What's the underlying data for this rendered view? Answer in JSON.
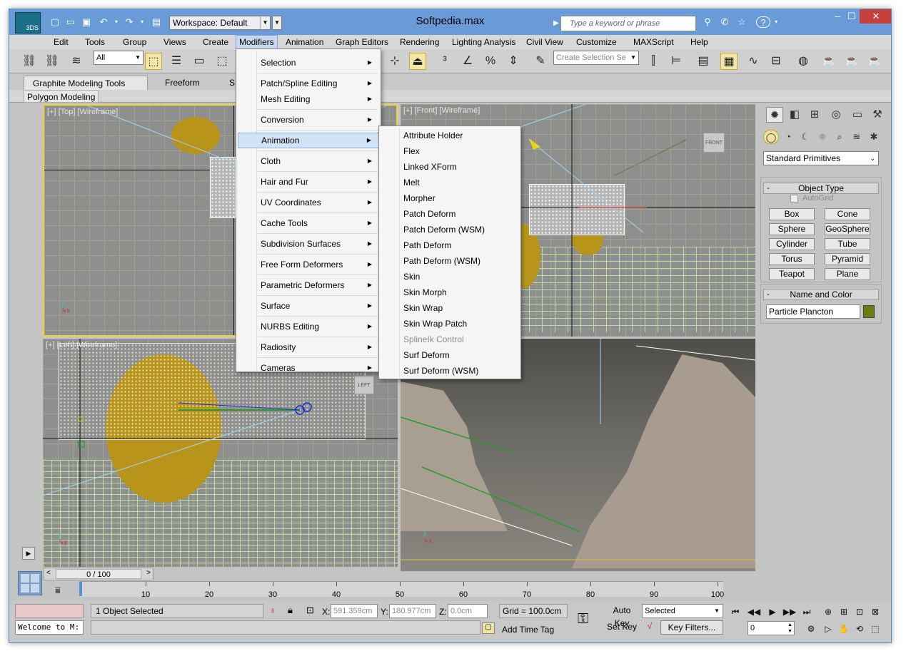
{
  "window": {
    "title": "Softpedia.max",
    "workspace": "Workspace: Default",
    "search_placeholder": "Type a keyword or phrase",
    "app_badge": "3DS",
    "min": "–",
    "max": "☐",
    "close": "✕"
  },
  "menubar": [
    "Edit",
    "Tools",
    "Group",
    "Views",
    "Create",
    "Modifiers",
    "Animation",
    "Graph Editors",
    "Rendering",
    "Lighting Analysis",
    "Civil View",
    "Customize",
    "MAXScript",
    "Help"
  ],
  "toolbar": {
    "filter": "All",
    "selection_set_placeholder": "Create Selection Se"
  },
  "ribbon": {
    "tabs": [
      "Graphite Modeling Tools",
      "Freeform",
      "S"
    ],
    "panel_label": "Polygon Modeling"
  },
  "viewports": {
    "top": "[+] [Top] [Wireframe]",
    "front": "[+] [Front] [Wireframe]",
    "left": "[+] [Left] [Wireframe]",
    "front_cube": "FRONT",
    "left_cube": "LEFT"
  },
  "modifiers_menu": [
    "Selection",
    "Patch/Spline Editing",
    "Mesh Editing",
    "Conversion",
    "Animation",
    "Cloth",
    "Hair and Fur",
    "UV Coordinates",
    "Cache Tools",
    "Subdivision Surfaces",
    "Free Form Deformers",
    "Parametric Deformers",
    "Surface",
    "NURBS Editing",
    "Radiosity",
    "Cameras"
  ],
  "animation_submenu": [
    "Attribute Holder",
    "Flex",
    "Linked XForm",
    "Melt",
    "Morpher",
    "Patch Deform",
    "Patch Deform (WSM)",
    "Path Deform",
    "Path Deform (WSM)",
    "Skin",
    "Skin Morph",
    "Skin Wrap",
    "Skin Wrap Patch",
    "SplineIk Control",
    "Surf Deform",
    "Surf Deform (WSM)"
  ],
  "command_panel": {
    "category": "Standard Primitives",
    "object_type_title": "Object Type",
    "autogrid": "AutoGrid",
    "primitives": [
      "Box",
      "Cone",
      "Sphere",
      "GeoSphere",
      "Cylinder",
      "Tube",
      "Torus",
      "Pyramid",
      "Teapot",
      "Plane"
    ],
    "name_color_title": "Name and Color",
    "object_name": "Particle Plancton",
    "object_color": "#6d7c12"
  },
  "timeline": {
    "frame_label": "0 / 100",
    "ticks": [
      "10",
      "20",
      "30",
      "40",
      "50",
      "60",
      "70",
      "80",
      "90",
      "100"
    ]
  },
  "status": {
    "selection": "1 Object Selected",
    "listener": "Welcome to M:",
    "x_label": "X:",
    "x_value": "591.359cm",
    "y_label": "Y:",
    "y_value": "180.977cm",
    "z_label": "Z:",
    "z_value": "0.0cm",
    "grid": "Grid = 100.0cm",
    "add_time_tag": "Add Time Tag",
    "auto_key": "Auto Key",
    "set_key": "Set Key",
    "key_mode": "Selected",
    "key_filters": "Key Filters...",
    "current_frame": "0"
  }
}
